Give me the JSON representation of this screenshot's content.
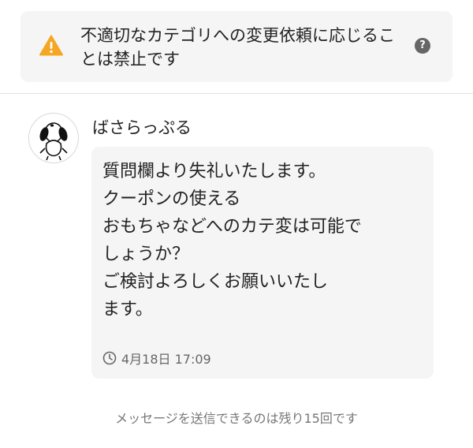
{
  "warning": {
    "icon": "warning-triangle-icon",
    "color": "#f5a623",
    "text": "不適切なカテゴリへの変更依頼に応じることは禁止です",
    "help_label": "?"
  },
  "message": {
    "sender": "ばさらっぷる",
    "avatar_icon": "dog-avatar-icon",
    "lines": [
      "質問欄より失礼いたします。",
      "クーポンの使える",
      "おもちゃなどへのカテ変は可能で",
      "しょうか？",
      "ご検討よろしくお願いいたし",
      "ます。"
    ],
    "timestamp_icon": "clock-icon",
    "timestamp": "4月18日 17:09"
  },
  "footer": {
    "remaining_text": "メッセージを送信できるのは残り15回です"
  }
}
